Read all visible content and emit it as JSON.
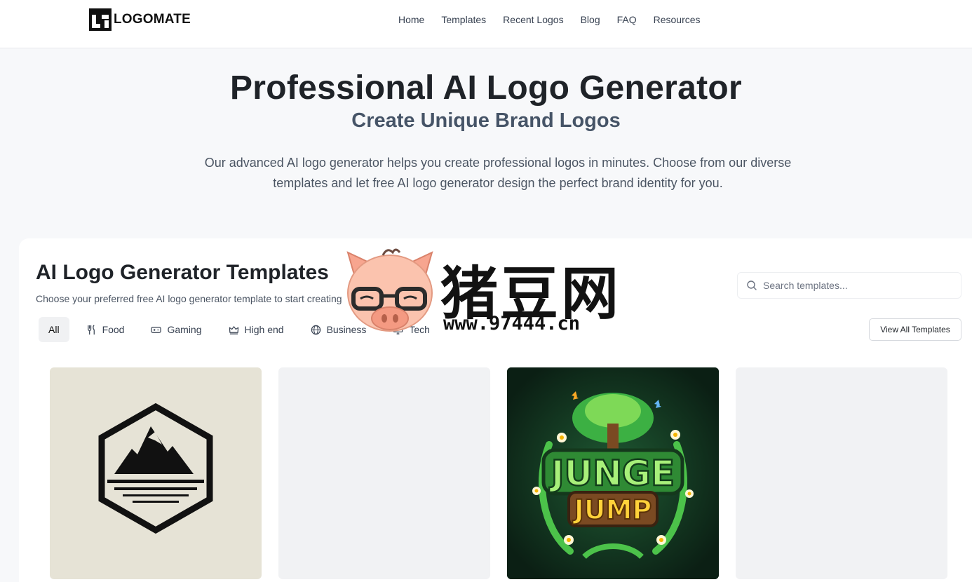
{
  "header": {
    "logo_text": "LOGOMATE",
    "nav": [
      "Home",
      "Templates",
      "Recent Logos",
      "Blog",
      "FAQ",
      "Resources"
    ]
  },
  "hero": {
    "title": "Professional AI Logo Generator",
    "subtitle": "Create Unique Brand Logos",
    "description": "Our advanced AI logo generator helps you create professional logos in minutes. Choose from our diverse templates and let free AI logo generator design the perfect brand identity for you."
  },
  "templates": {
    "title": "AI Logo Generator Templates",
    "subtitle": "Choose your preferred free AI logo generator template to start creating",
    "search_placeholder": "Search templates...",
    "view_all_label": "View All Templates",
    "categories": [
      {
        "label": "All",
        "icon": "none",
        "active": true
      },
      {
        "label": "Food",
        "icon": "utensils-icon"
      },
      {
        "label": "Gaming",
        "icon": "gamepad-icon"
      },
      {
        "label": "High end",
        "icon": "crown-icon"
      },
      {
        "label": "Business",
        "icon": "globe-icon"
      },
      {
        "label": "Tech",
        "icon": "monitor-icon"
      }
    ],
    "cards": [
      {
        "name": "mountain-hexagon-logo"
      },
      {
        "name": "empty-placeholder"
      },
      {
        "name": "junge-jump-logo",
        "text_line1": "JUNGE",
        "text_line2": "JUMP"
      },
      {
        "name": "empty-placeholder"
      }
    ]
  },
  "watermark": {
    "cn_text": "猪豆网",
    "url": "www.97444.cn"
  }
}
